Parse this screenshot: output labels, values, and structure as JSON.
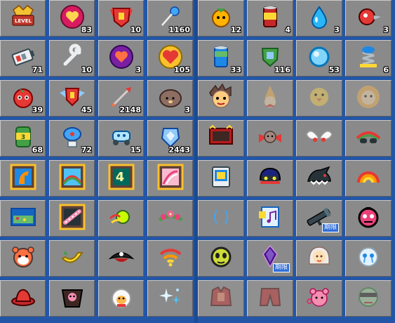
{
  "left_items": [
    {
      "name": "level-badge",
      "icon": "level-badge",
      "qty": ""
    },
    {
      "name": "pink-heart-coin",
      "icon": "heart-coin",
      "qty": "83"
    },
    {
      "name": "red-shield",
      "icon": "red-shield",
      "qty": "10"
    },
    {
      "name": "blue-pin",
      "icon": "blue-pin",
      "qty": "1160"
    },
    {
      "name": "battery-item",
      "icon": "battery",
      "qty": "71"
    },
    {
      "name": "wrench",
      "icon": "wrench",
      "qty": "10"
    },
    {
      "name": "purple-heart-coin",
      "icon": "purple-coin",
      "qty": "3"
    },
    {
      "name": "heart-locket",
      "icon": "heart-locket",
      "qty": "105"
    },
    {
      "name": "strawberry-bot",
      "icon": "strawberry",
      "qty": "39"
    },
    {
      "name": "winged-shield",
      "icon": "winged-shield",
      "qty": "45"
    },
    {
      "name": "dart",
      "icon": "dart",
      "qty": "2148"
    },
    {
      "name": "hedgehog",
      "icon": "hedgehog",
      "qty": "3"
    },
    {
      "name": "green-can",
      "icon": "green-can",
      "qty": "68"
    },
    {
      "name": "satellite-dish",
      "icon": "satellite",
      "qty": "72"
    },
    {
      "name": "robot-car",
      "icon": "robot-car",
      "qty": "15"
    },
    {
      "name": "blue-gem-shield",
      "icon": "blue-gem",
      "qty": "2443"
    },
    {
      "name": "horse-frame",
      "icon": "frame-horse",
      "qty": ""
    },
    {
      "name": "rainbow-frame",
      "icon": "frame-rainbow",
      "qty": ""
    },
    {
      "name": "level4-frame",
      "icon": "frame-level4",
      "qty": ""
    },
    {
      "name": "pink-frame",
      "icon": "frame-pink",
      "qty": ""
    },
    {
      "name": "landscape-card",
      "icon": "landscape",
      "qty": ""
    },
    {
      "name": "candy-frame",
      "icon": "frame-candy",
      "qty": ""
    },
    {
      "name": "green-orb",
      "icon": "green-orb",
      "qty": ""
    },
    {
      "name": "flower-crown",
      "icon": "flower-crown",
      "qty": ""
    },
    {
      "name": "red-panda",
      "icon": "red-panda",
      "qty": ""
    },
    {
      "name": "yellow-boat",
      "icon": "yellow-boat",
      "qty": ""
    },
    {
      "name": "pirate-hat",
      "icon": "pirate-hat",
      "qty": ""
    },
    {
      "name": "wifi-signal",
      "icon": "wifi",
      "qty": ""
    },
    {
      "name": "red-hat",
      "icon": "red-hat",
      "qty": ""
    },
    {
      "name": "dark-skull-cape",
      "icon": "skull-cape",
      "qty": ""
    },
    {
      "name": "sheep-doll",
      "icon": "sheep",
      "qty": ""
    },
    {
      "name": "sparkle-stars",
      "icon": "sparkles",
      "qty": ""
    }
  ],
  "right_items": [
    {
      "name": "orange-fruit-bot",
      "icon": "orange-bot",
      "qty": "12",
      "faded": false
    },
    {
      "name": "soda-can",
      "icon": "soda-can",
      "qty": "4",
      "faded": false
    },
    {
      "name": "water-drop",
      "icon": "water-drop",
      "qty": "3",
      "faded": false
    },
    {
      "name": "drill-bot",
      "icon": "drill",
      "qty": "3",
      "faded": false
    },
    {
      "name": "blue-can",
      "icon": "blue-can",
      "qty": "33",
      "faded": false
    },
    {
      "name": "green-shield",
      "icon": "green-shield",
      "qty": "116",
      "faded": false
    },
    {
      "name": "magnifier-orb",
      "icon": "magnifier",
      "qty": "53",
      "faded": false
    },
    {
      "name": "spring-toy",
      "icon": "spring",
      "qty": "6",
      "faded": false
    },
    {
      "name": "spiky-hair-boy",
      "icon": "boy-face",
      "qty": "",
      "faded": false
    },
    {
      "name": "party-hat-ghost",
      "icon": "party-hat",
      "qty": "",
      "faded": true
    },
    {
      "name": "yellow-chick",
      "icon": "chick",
      "qty": "",
      "faded": true
    },
    {
      "name": "lion-face",
      "icon": "lion",
      "qty": "",
      "faded": true
    },
    {
      "name": "red-monitor",
      "icon": "red-monitor",
      "qty": "",
      "faded": false
    },
    {
      "name": "ribbon-bear",
      "icon": "ribbon-bear",
      "qty": "",
      "faded": false
    },
    {
      "name": "white-wings",
      "icon": "wings",
      "qty": "",
      "faded": false
    },
    {
      "name": "rainbow-goggles",
      "icon": "goggles",
      "qty": "",
      "faded": false
    },
    {
      "name": "blue-device",
      "icon": "device",
      "qty": "",
      "faded": false
    },
    {
      "name": "robot-helmet",
      "icon": "helmet",
      "qty": "",
      "faded": false
    },
    {
      "name": "shark-hat",
      "icon": "shark-hat",
      "qty": "",
      "faded": false
    },
    {
      "name": "rainbow-arch",
      "icon": "rainbow-arch",
      "qty": "",
      "faded": false
    },
    {
      "name": "blue-whiskers",
      "icon": "whiskers",
      "qty": "",
      "faded": false
    },
    {
      "name": "music-card",
      "icon": "music-card",
      "qty": "",
      "faded": false
    },
    {
      "name": "bazooka",
      "icon": "bazooka",
      "qty": "",
      "faded": false,
      "tag": "期限"
    },
    {
      "name": "skull-mask",
      "icon": "skull-mask",
      "qty": "",
      "faded": false
    },
    {
      "name": "alien-head",
      "icon": "alien",
      "qty": "",
      "faded": false
    },
    {
      "name": "purple-crystal",
      "icon": "crystal",
      "qty": "",
      "faded": false,
      "tag": "期限"
    },
    {
      "name": "doll-girl",
      "icon": "doll-girl",
      "qty": "",
      "faded": false
    },
    {
      "name": "crying-ghost",
      "icon": "crying-ghost",
      "qty": "",
      "faded": false
    },
    {
      "name": "red-jacket",
      "icon": "red-jacket",
      "qty": "",
      "faded": true
    },
    {
      "name": "red-pants",
      "icon": "red-pants",
      "qty": "",
      "faded": true
    },
    {
      "name": "pink-bear",
      "icon": "pink-bear",
      "qty": "",
      "faded": false
    },
    {
      "name": "masked-face",
      "icon": "masked-face",
      "qty": "",
      "faded": true
    }
  ]
}
